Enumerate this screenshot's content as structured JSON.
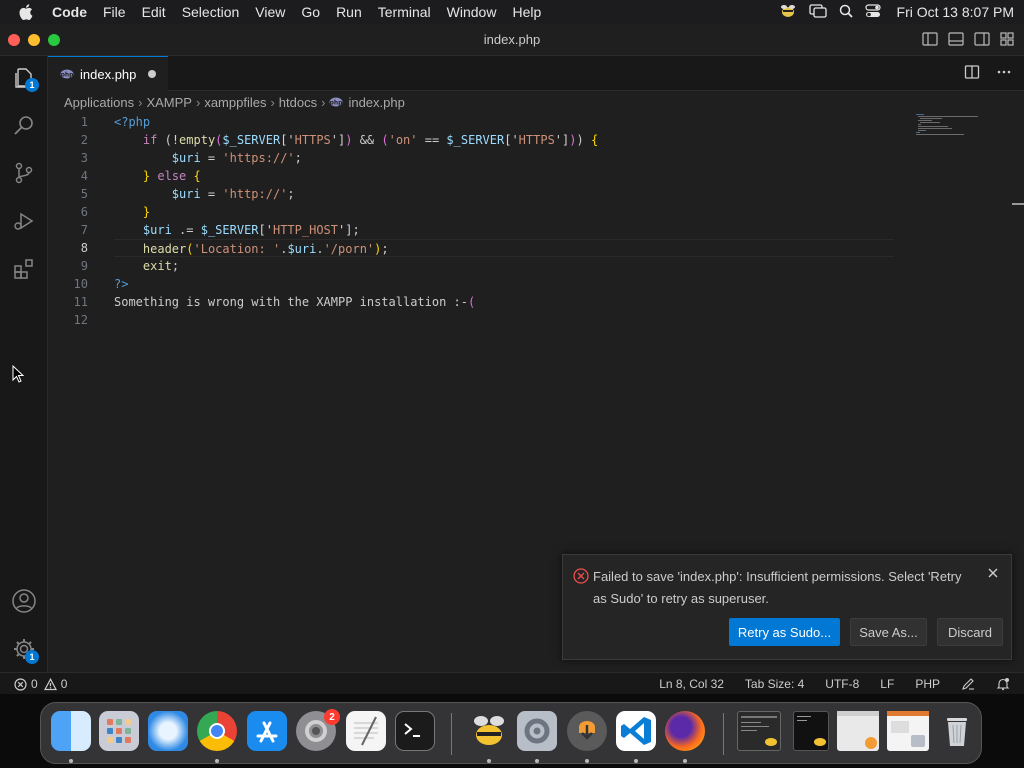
{
  "menubar": {
    "app": "Code",
    "items": [
      "File",
      "Edit",
      "Selection",
      "View",
      "Go",
      "Run",
      "Terminal",
      "Window",
      "Help"
    ],
    "clock": "Fri Oct 13  8:07 PM"
  },
  "window": {
    "title": "index.php"
  },
  "activity": {
    "explorer_badge": "1",
    "settings_badge": "1"
  },
  "tab": {
    "label": "index.php"
  },
  "breadcrumb": [
    "Applications",
    "XAMPP",
    "xamppfiles",
    "htdocs",
    "index.php"
  ],
  "editor": {
    "line_numbers": [
      "1",
      "2",
      "3",
      "4",
      "5",
      "6",
      "7",
      "8",
      "9",
      "10",
      "11",
      "12"
    ],
    "active_line": "8",
    "lines": [
      [
        {
          "t": "<?php",
          "c": "tag"
        }
      ],
      [
        {
          "t": "    "
        },
        {
          "t": "if",
          "c": "ctl"
        },
        {
          "t": " ("
        },
        {
          "t": "!",
          "c": "pun"
        },
        {
          "t": "empty",
          "c": "fn"
        },
        {
          "t": "(",
          "c": "br2"
        },
        {
          "t": "$_SERVER",
          "c": "var"
        },
        {
          "t": "['",
          "c": "pun"
        },
        {
          "t": "HTTPS",
          "c": "str"
        },
        {
          "t": "']",
          "c": "pun"
        },
        {
          "t": ")",
          "c": "br2"
        },
        {
          "t": " && "
        },
        {
          "t": "(",
          "c": "br2"
        },
        {
          "t": "'on'",
          "c": "str"
        },
        {
          "t": " == "
        },
        {
          "t": "$_SERVER",
          "c": "var"
        },
        {
          "t": "['",
          "c": "pun"
        },
        {
          "t": "HTTPS",
          "c": "str"
        },
        {
          "t": "']",
          "c": "pun"
        },
        {
          "t": ")",
          "c": "br2"
        },
        {
          "t": ")"
        },
        {
          "t": " {",
          "c": "br1"
        }
      ],
      [
        {
          "t": "        "
        },
        {
          "t": "$uri",
          "c": "var"
        },
        {
          "t": " = "
        },
        {
          "t": "'https://'",
          "c": "str"
        },
        {
          "t": ";"
        }
      ],
      [
        {
          "t": "    "
        },
        {
          "t": "}",
          "c": "br1"
        },
        {
          "t": " "
        },
        {
          "t": "else",
          "c": "ctl"
        },
        {
          "t": " "
        },
        {
          "t": "{",
          "c": "br1"
        }
      ],
      [
        {
          "t": "        "
        },
        {
          "t": "$uri",
          "c": "var"
        },
        {
          "t": " = "
        },
        {
          "t": "'http://'",
          "c": "str"
        },
        {
          "t": ";"
        }
      ],
      [
        {
          "t": "    "
        },
        {
          "t": "}",
          "c": "br1"
        }
      ],
      [
        {
          "t": "    "
        },
        {
          "t": "$uri",
          "c": "var"
        },
        {
          "t": " .= "
        },
        {
          "t": "$_SERVER",
          "c": "var"
        },
        {
          "t": "['",
          "c": "pun"
        },
        {
          "t": "HTTP_HOST",
          "c": "str"
        },
        {
          "t": "']",
          "c": "pun"
        },
        {
          "t": ";"
        }
      ],
      [
        {
          "t": "    "
        },
        {
          "t": "header",
          "c": "fn"
        },
        {
          "t": "(",
          "c": "br1"
        },
        {
          "t": "'Location: '",
          "c": "str"
        },
        {
          "t": "."
        },
        {
          "t": "$uri",
          "c": "var"
        },
        {
          "t": "."
        },
        {
          "t": "'/porn'",
          "c": "str"
        },
        {
          "t": ")",
          "c": "br1"
        },
        {
          "t": ";"
        }
      ],
      [
        {
          "t": "    "
        },
        {
          "t": "exit",
          "c": "fn"
        },
        {
          "t": ";"
        }
      ],
      [
        {
          "t": "?>",
          "c": "tag"
        }
      ],
      [
        {
          "t": "Something is wrong with the XAMPP installation :-"
        },
        {
          "t": "(",
          "c": "br2"
        }
      ],
      []
    ]
  },
  "notification": {
    "message": "Failed to save 'index.php': Insufficient permissions. Select 'Retry as Sudo' to retry as superuser.",
    "primary_button": "Retry as Sudo...",
    "save_as_button": "Save As...",
    "discard_button": "Discard"
  },
  "statusbar": {
    "errors": "0",
    "warnings": "0",
    "position": "Ln 8, Col 32",
    "tab_size": "Tab Size: 4",
    "encoding": "UTF-8",
    "eol": "LF",
    "language": "PHP"
  },
  "dock": {
    "settings_badge": "2",
    "apps": [
      "finder-icon",
      "launchpad-icon",
      "safari-icon",
      "chrome-icon",
      "app-store-icon",
      "system-settings-icon",
      "textedit-icon",
      "terminal-icon",
      "cyberduck-icon",
      "xampp-manager-icon",
      "downloader-icon",
      "vscode-icon",
      "firefox-icon",
      "window-thumb-1",
      "window-thumb-2",
      "window-thumb-3",
      "window-thumb-4",
      "trash-icon"
    ]
  },
  "colors": {
    "accent": "#0078d4",
    "error": "#f14c4c",
    "editor_bg": "#1f1f1f"
  }
}
